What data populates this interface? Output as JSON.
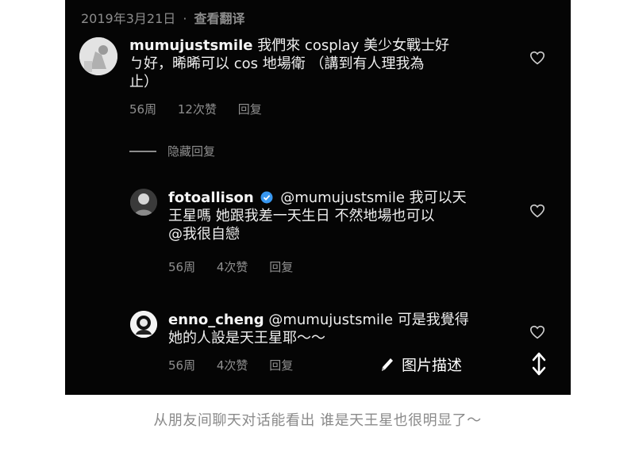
{
  "top": {
    "date": "2019年3月21日",
    "dot": "·",
    "translate": "查看翻译"
  },
  "comments": [
    {
      "username": "mumujustsmile",
      "line1": "我們來 cosplay 美少女戰士好",
      "line2": "ㄅ好，晞晞可以 cos 地場衛 （講到有人理我為",
      "line3": "止）",
      "time": "56周",
      "likes": "12次赞",
      "reply": "回复"
    },
    {
      "username": "fotoallison",
      "verified": true,
      "line1": "@mumujustsmile 我可以天",
      "line2": "王星嗎 她跟我差一天生日 不然地場也可以",
      "line3": "@我很自戀",
      "time": "56周",
      "likes": "4次赞",
      "reply": "回复"
    },
    {
      "username": "enno_cheng",
      "line1": "@mumujustsmile 可是我覺得",
      "line2": "她的人設是天王星耶～～",
      "time": "56周",
      "likes": "4次赞",
      "reply": "回复"
    }
  ],
  "hide_replies": "隐藏回复",
  "overlay": {
    "describe_label": "图片描述",
    "pencil_icon": "pencil-icon",
    "expand_icon": "vertical-arrows-icon"
  },
  "caption": "从朋友间聊天对话能看出 谁是天王星也很明显了～"
}
